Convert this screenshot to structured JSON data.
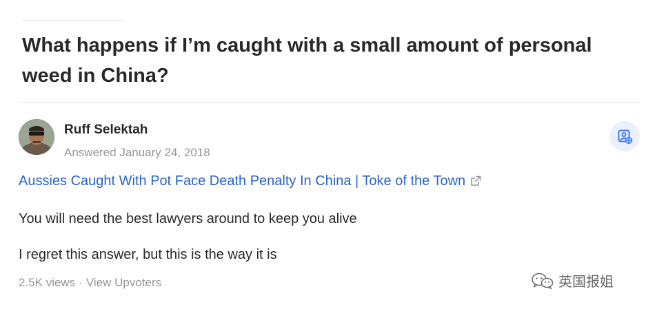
{
  "question": {
    "title": "What happens if I’m caught with a small amount of personal weed in China?"
  },
  "answer": {
    "author_name": "Ruff Selektah",
    "answered_date": "Answered January 24, 2018",
    "link_text": "Aussies Caught With Pot Face Death Penalty In China | Toke of the Town",
    "body_lines": [
      "You will need the best lawyers around to keep you alive",
      "I regret this answer, but this is the way it is"
    ],
    "views": "2.5K views",
    "separator": "·",
    "view_upvoters": "View Upvoters"
  },
  "icons": {
    "avatar": "avatar-photo",
    "action": "add-to-space-icon",
    "external_link": "external-link-icon",
    "watermark_logo": "wechat-logo-icon"
  },
  "watermark": {
    "text": "英国报姐"
  },
  "colors": {
    "link": "#2b63c7",
    "action_bg": "#eaf0fd",
    "action_icon": "#2e69ff",
    "muted_text": "#939598"
  }
}
